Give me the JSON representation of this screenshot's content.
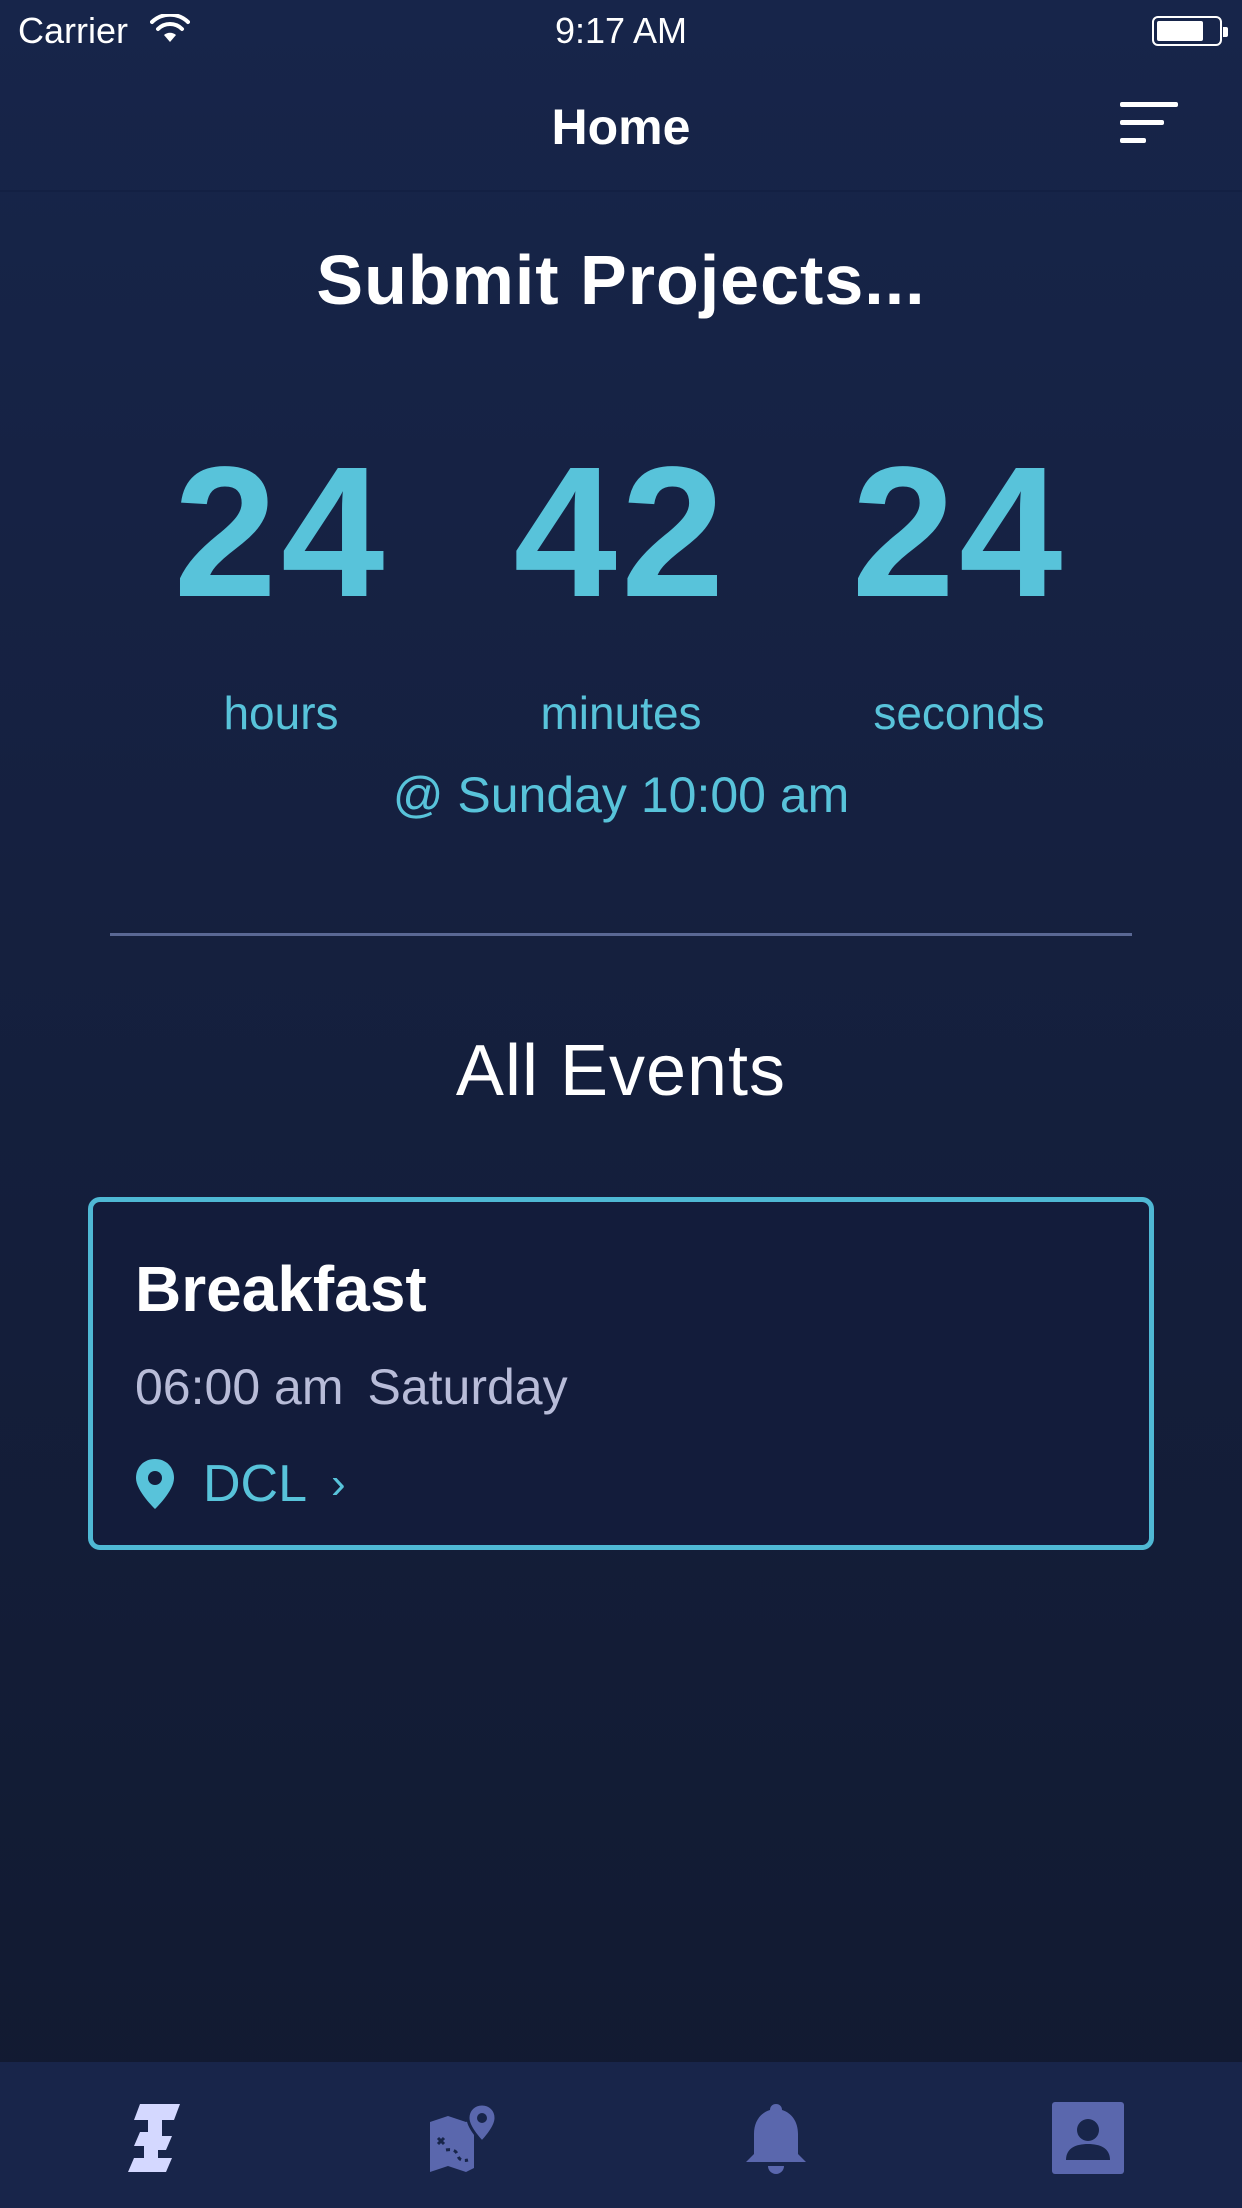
{
  "status_bar": {
    "carrier": "Carrier",
    "time": "9:17 AM"
  },
  "nav": {
    "title": "Home",
    "menu_icon": "menu-lines-icon"
  },
  "countdown": {
    "title": "Submit Projects...",
    "hours": "24",
    "hours_label": "hours",
    "minutes": "42",
    "minutes_label": "minutes",
    "seconds": "24",
    "seconds_label": "seconds",
    "deadline": "@ Sunday 10:00 am"
  },
  "events": {
    "title": "All Events",
    "items": [
      {
        "name": "Breakfast",
        "time": "06:00 am",
        "day": "Saturday",
        "location": "DCL",
        "location_icon": "map-pin-icon",
        "chevron": "›"
      }
    ]
  },
  "tabs": [
    {
      "name": "home-tab",
      "icon": "hackathon-logo-icon",
      "active": true
    },
    {
      "name": "map-tab",
      "icon": "map-icon",
      "active": false
    },
    {
      "name": "notifications-tab",
      "icon": "bell-icon",
      "active": false
    },
    {
      "name": "profile-tab",
      "icon": "profile-icon",
      "active": false
    }
  ],
  "colors": {
    "accent": "#58c3da",
    "background": "#15203f",
    "tab_active": "#d4d8ff",
    "tab_inactive": "#5a67ad"
  }
}
